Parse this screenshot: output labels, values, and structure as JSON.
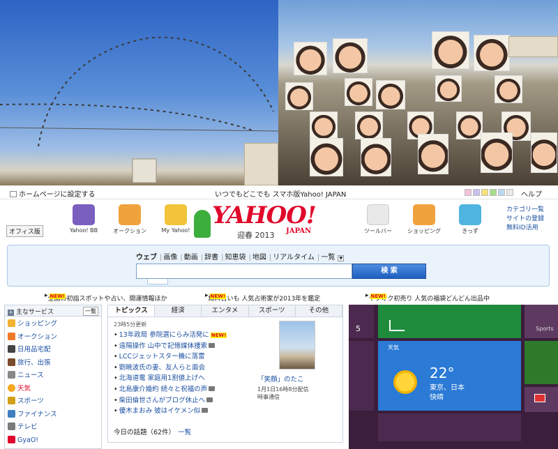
{
  "topbar": {
    "home_set": "ホームページに設定する",
    "tagline": "いつでもどこでも スマホ版Yahoo! JAPAN",
    "help": "ヘルプ",
    "swatch_colors": [
      "#f4c1d8",
      "#c9c1f0",
      "#f7e27a",
      "#a8dc8b",
      "#bcd9f2",
      "#e8e8e8"
    ]
  },
  "header": {
    "office": "オフィス版",
    "services": [
      {
        "label": "Yahoo! BB",
        "icon": "yahoo-bb-icon",
        "color": "#7a5fbf"
      },
      {
        "label": "オークション",
        "icon": "auction-icon",
        "color": "#f0a33c"
      },
      {
        "label": "My Yahoo!",
        "icon": "my-yahoo-icon",
        "color": "#f2c43a"
      },
      {
        "label": "ツールバー",
        "icon": "toolbar-icon",
        "color": "#e9e9e9"
      },
      {
        "label": "ショッピング",
        "icon": "shopping-icon",
        "color": "#f0a33c"
      },
      {
        "label": "きっず",
        "icon": "kids-icon",
        "color": "#4fb4e0"
      }
    ],
    "logo_text": "YAHOO!",
    "logo_sub": "JAPAN",
    "logo_year": "迎春 2013",
    "right_links": [
      "カテゴリ一覧",
      "サイトの登録",
      "無料ID活用"
    ]
  },
  "search": {
    "tabs": [
      "ウェブ",
      "画像",
      "動画",
      "辞書",
      "知恵袋",
      "地図",
      "リアルタイム",
      "一覧"
    ],
    "input_value": "",
    "button": "検 索"
  },
  "ticker": [
    {
      "text": "全国の初詣スポットや占い、開運情報ほか",
      "new": "NEW!"
    },
    {
      "text": "無料占いも 人気占術家が2013年を鑑定",
      "new": "NEW!"
    },
    {
      "text": "ヤフオク初売り 人気の福袋どんどん出品中",
      "new": "NEW!"
    }
  ],
  "services": {
    "head": "主なサービス",
    "ichiran": "一覧",
    "items": [
      {
        "label": "ショッピング",
        "color": "#f2b233"
      },
      {
        "label": "オークション",
        "color": "#f07a2a"
      },
      {
        "label": "日用品宅配",
        "color": "#444444"
      },
      {
        "label": "旅行、出張",
        "color": "#7a4a2a"
      },
      {
        "label": "ニュース",
        "color": "#888888"
      },
      {
        "label": "天気",
        "color": "#f5a623"
      },
      {
        "label": "スポーツ",
        "color": "#d4a017"
      },
      {
        "label": "ファイナンス",
        "color": "#3f7fc1"
      },
      {
        "label": "テレビ",
        "color": "#7a7a7a"
      },
      {
        "label": "GyaO!",
        "color": "#e0092b"
      }
    ]
  },
  "topics": {
    "tabs": [
      "トピックス",
      "経済",
      "エンタメ",
      "スポーツ",
      "その他"
    ],
    "updated": "23時5分更新",
    "items": [
      {
        "text": "13年政局 参院選にらみ活発に",
        "new": "NEW!",
        "camera": false
      },
      {
        "text": "遠隔操作 山中で記憶媒体捜索",
        "new": "",
        "camera": true
      },
      {
        "text": "LCCジェットスター機に落雷",
        "new": "",
        "camera": false
      },
      {
        "text": "劉暁波氏の妻、友人らと面会",
        "new": "",
        "camera": false
      },
      {
        "text": "北海道電 家庭用1割値上げへ",
        "new": "",
        "camera": false
      },
      {
        "text": "北島康介婚約 続々と祝福の声",
        "new": "",
        "camera": true
      },
      {
        "text": "柴田倫世さんがブログ休止へ",
        "new": "",
        "camera": true
      },
      {
        "text": "優木まおみ 彼はイケメン似",
        "new": "",
        "camera": true
      }
    ],
    "today": "今日の話題（62件）",
    "today_list": "一覧",
    "pick": {
      "title": "「笑顔」のたこ",
      "meta": "1月1日16時8分配信",
      "source": "時事通信"
    }
  },
  "tiles": {
    "tile5": "5",
    "sports": "Sports",
    "weather_label": "天気",
    "temp": "22°",
    "city": "東京、日本",
    "condition": "快晴"
  }
}
